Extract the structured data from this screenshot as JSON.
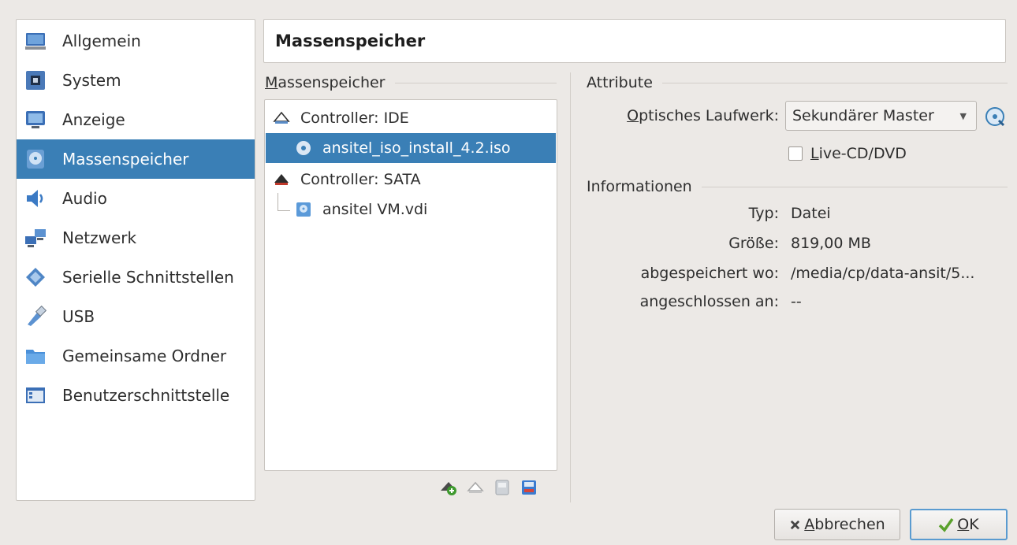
{
  "sidebar": {
    "items": [
      {
        "label": "Allgemein",
        "icon": "general-icon"
      },
      {
        "label": "System",
        "icon": "system-icon"
      },
      {
        "label": "Anzeige",
        "icon": "display-icon"
      },
      {
        "label": "Massenspeicher",
        "icon": "storage-icon",
        "selected": true
      },
      {
        "label": "Audio",
        "icon": "audio-icon"
      },
      {
        "label": "Netzwerk",
        "icon": "network-icon"
      },
      {
        "label": "Serielle Schnittstellen",
        "icon": "serial-ports-icon"
      },
      {
        "label": "USB",
        "icon": "usb-icon"
      },
      {
        "label": "Gemeinsame Ordner",
        "icon": "shared-folders-icon"
      },
      {
        "label": "Benutzerschnittstelle",
        "icon": "user-interface-icon"
      }
    ]
  },
  "header": {
    "title": "Massenspeicher"
  },
  "storage": {
    "group_title_first": "M",
    "group_title_rest": "assenspeicher",
    "tree": [
      {
        "label": "Controller: IDE",
        "icon": "ide-controller-icon"
      },
      {
        "label": "ansitel_iso_install_4.2.iso",
        "icon": "optical-disc-icon",
        "selected": true
      },
      {
        "label": "Controller: SATA",
        "icon": "sata-controller-icon"
      },
      {
        "label": "ansitel VM.vdi",
        "icon": "hard-disk-icon"
      }
    ],
    "toolbar": [
      "add-attachment-icon",
      "add-controller-icon",
      "remove-attachment-icon",
      "remove-controller-icon"
    ]
  },
  "attributes": {
    "title": "Attribute",
    "optical_drive_label_first": "O",
    "optical_drive_label_rest": "ptisches Laufwerk:",
    "optical_drive_value": "Sekundärer Master",
    "live_cd_first": "L",
    "live_cd_rest": "ive-CD/DVD",
    "live_cd_checked": false
  },
  "information": {
    "title": "Informationen",
    "rows": [
      {
        "label": "Typ:",
        "value": "Datei"
      },
      {
        "label": "Größe:",
        "value": "819,00 MB"
      },
      {
        "label": "abgespeichert wo:",
        "value": "/media/cp/data-ansit/5..."
      },
      {
        "label": "angeschlossen an:",
        "value": "--"
      }
    ]
  },
  "buttons": {
    "cancel_first": "A",
    "cancel_rest": "bbrechen",
    "ok_first": "O",
    "ok_rest": "K"
  },
  "colors": {
    "selection": "#3a7fb6",
    "background": "#ece9e6",
    "ok_border": "#5a9bd0"
  }
}
